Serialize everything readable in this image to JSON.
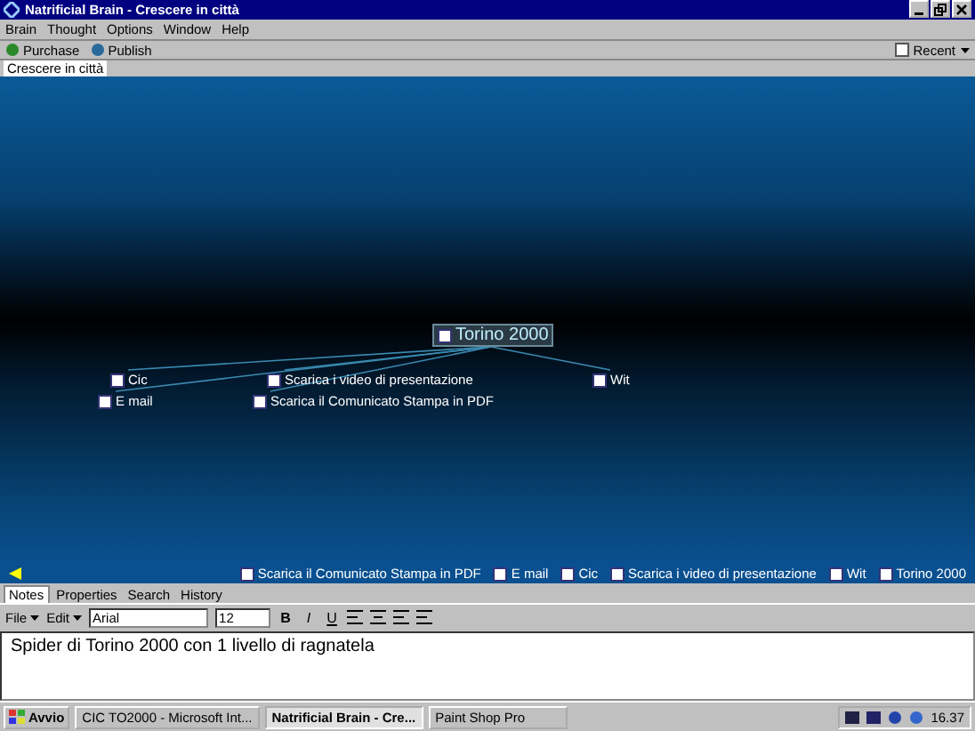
{
  "window": {
    "title": "Natrificial Brain - Crescere in città"
  },
  "menu": [
    "Brain",
    "Thought",
    "Options",
    "Window",
    "Help"
  ],
  "toolbar": {
    "buttons": [
      "Purchase",
      "Publish"
    ],
    "recent": "Recent"
  },
  "brain_tabs": [
    {
      "label": "Crescere in città",
      "selected": true
    }
  ],
  "plex": {
    "central": "Torino 2000",
    "children": [
      {
        "label": "Cic"
      },
      {
        "label": "E mail"
      },
      {
        "label": "Scarica i video di presentazione"
      },
      {
        "label": "Scarica il Comunicato Stampa in PDF"
      },
      {
        "label": "Wit"
      }
    ]
  },
  "breadcrumbs": [
    "Scarica il Comunicato Stampa in PDF",
    "E mail",
    "Cic",
    "Scarica i video di presentazione",
    "Wit",
    "Torino 2000"
  ],
  "notes_tabs": [
    {
      "label": "Notes",
      "selected": true
    },
    {
      "label": "Properties",
      "selected": false
    },
    {
      "label": "Search",
      "selected": false
    },
    {
      "label": "History",
      "selected": false
    }
  ],
  "editor": {
    "menus": [
      "File",
      "Edit"
    ],
    "format_buttons": [
      "B",
      "I",
      "U"
    ],
    "font": "Arial",
    "size": "12",
    "text": "Spider di Torino 2000 con 1 livello di ragnatela"
  },
  "taskbar": {
    "start": "Avvio",
    "tasks": [
      {
        "label": "CIC TO2000 - Microsoft Int...",
        "selected": false
      },
      {
        "label": "Natrificial Brain - Cre...",
        "selected": true
      },
      {
        "label": "Paint Shop Pro",
        "selected": false
      }
    ],
    "clock": "16.37"
  }
}
